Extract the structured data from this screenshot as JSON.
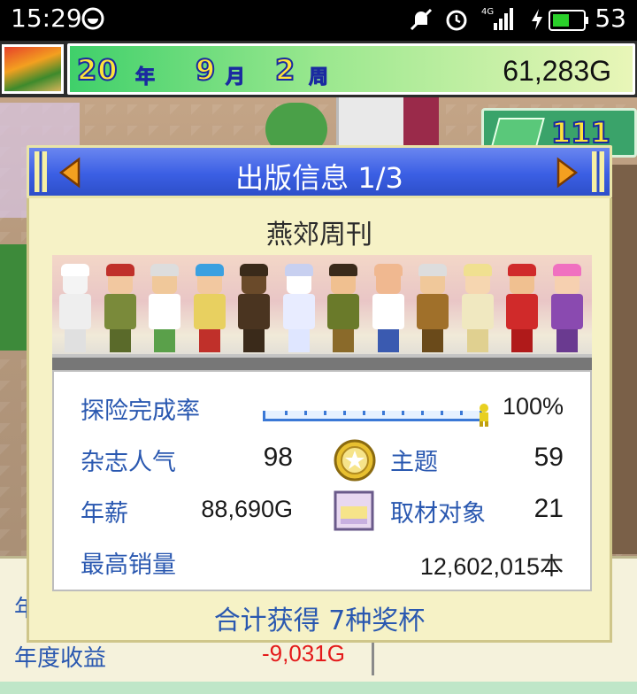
{
  "statusbar": {
    "time": "15:29",
    "network": "4G",
    "battery": "53"
  },
  "hud": {
    "year": "20",
    "year_unit": "年",
    "month": "9",
    "month_unit": "月",
    "week": "2",
    "week_unit": "周",
    "money": "61,283G"
  },
  "right_chip": {
    "count": "111"
  },
  "dialog": {
    "title": "出版信息 1/3",
    "magazine_name": "燕郊周刊",
    "stats": {
      "exploration_label": "探险完成率",
      "exploration_value": "100%",
      "exploration_progress": 1.0,
      "popularity_label": "杂志人气",
      "popularity_value": "98",
      "theme_label": "主题",
      "theme_value": "59",
      "salary_label": "年薪",
      "salary_value": "88,690G",
      "subject_label": "取材对象",
      "subject_value": "21",
      "best_sales_label": "最高销量",
      "best_sales_value": "12,602,015本"
    },
    "footer": "合计获得 7种奖杯"
  },
  "bottom_panel": {
    "row1_label": "年",
    "row2_label": "年度收益",
    "row2_value": "-9,031G"
  },
  "colors": {
    "dialog_header": "#3b5fe4",
    "label_blue": "#2a58b0",
    "parchment": "#f6f2c6",
    "negative": "#e41a1a"
  },
  "characters": [
    {
      "name": "polar-bear",
      "hair": "#ffffff",
      "skin": "#f4f4f4",
      "top": "#eeeeee",
      "legs": "#e0e0e0"
    },
    {
      "name": "red-bow-girl",
      "hair": "#c0302a",
      "skin": "#f2c8a0",
      "top": "#7a8a3a",
      "legs": "#5a6a2a"
    },
    {
      "name": "old-man-green",
      "hair": "#dddddd",
      "skin": "#f0c89a",
      "top": "#ffffff",
      "legs": "#5aa04a"
    },
    {
      "name": "blue-hat-girl",
      "hair": "#3aa0e0",
      "skin": "#f2c8a0",
      "top": "#e8d060",
      "legs": "#c0302a"
    },
    {
      "name": "monkey",
      "hair": "#3a2a1a",
      "skin": "#6a4a2a",
      "top": "#4a3420",
      "legs": "#3a2a1a"
    },
    {
      "name": "ghost-lady",
      "hair": "#c8d0f0",
      "skin": "#ffffff",
      "top": "#e8ecff",
      "legs": "#dfe6ff"
    },
    {
      "name": "explorer",
      "hair": "#3a2a1a",
      "skin": "#f0c090",
      "top": "#6a7a2a",
      "legs": "#8a6a2a"
    },
    {
      "name": "bald-man",
      "hair": "#f0b890",
      "skin": "#f0b890",
      "top": "#ffffff",
      "legs": "#3a5ab0"
    },
    {
      "name": "old-man-brown",
      "hair": "#dddddd",
      "skin": "#f0c89a",
      "top": "#a0702a",
      "legs": "#6a4a1a"
    },
    {
      "name": "blonde-lady",
      "hair": "#f0e090",
      "skin": "#f6d6b0",
      "top": "#f0e8c0",
      "legs": "#e0d090"
    },
    {
      "name": "red-ninja",
      "hair": "#d02a2a",
      "skin": "#f0c090",
      "top": "#d02a2a",
      "legs": "#b01a1a"
    },
    {
      "name": "pink-girl",
      "hair": "#f070c0",
      "skin": "#f6d0b0",
      "top": "#8a4ab0",
      "legs": "#6a3a90"
    }
  ]
}
